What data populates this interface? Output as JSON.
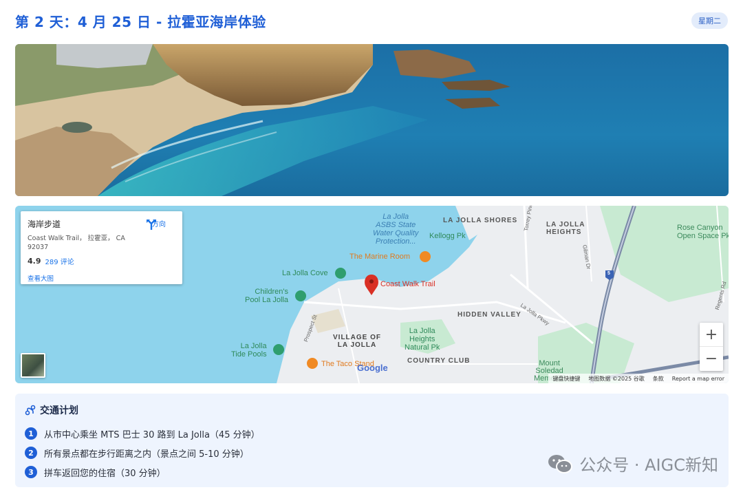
{
  "header": {
    "title": "第 2 天：4 月 25 日 - 拉霍亚海岸体验",
    "day_badge": "星期二"
  },
  "map": {
    "place_card": {
      "name": "海岸步道",
      "address": "Coast Walk Trail， 拉霍亚， CA 92037",
      "rating": "4.9",
      "reviews": "289 评论",
      "big_map_link": "查看大图",
      "directions_label": "方向"
    },
    "labels": {
      "asbs": [
        "La Jolla",
        "ASBS State",
        "Water Quality",
        "Protection..."
      ],
      "la_jolla_shores": "LA JOLLA SHORES",
      "la_jolla_heights": [
        "LA JOLLA",
        "HEIGHTS"
      ],
      "rose_canyon": [
        "Rose Canyon",
        "Open Space Pk"
      ],
      "kellogg": "Kellogg Pk",
      "marine_room": "The Marine Room",
      "la_jolla_cove": "La Jolla Cove",
      "coast_walk": "Coast Walk Trail",
      "childrens_pool": [
        "Children's",
        "Pool La Jolla"
      ],
      "hidden_valley": "HIDDEN VALLEY",
      "village": [
        "VILLAGE OF",
        "LA JOLLA"
      ],
      "heights_park": [
        "La Jolla",
        "Heights",
        "Natural Pk"
      ],
      "tide_pools": [
        "La Jolla",
        "Tide Pools"
      ],
      "taco_stand": "The Taco Stand",
      "country_club": "COUNTRY CLUB",
      "mount_soledad": [
        "Mount",
        "Soledad",
        "Memorial"
      ],
      "torrey_pines": "Torrey Pines",
      "gilman": "Gilman Dr",
      "regents": "Regents Rd",
      "prospect": "Prospect St",
      "parkway": "La Jolla Pkwy",
      "interstate": "5",
      "google": "Google"
    },
    "footer": {
      "shortcuts": "键盘快捷键",
      "data": "地图数据 ©2025 谷歌",
      "terms": "条款",
      "report": "Report a map error"
    },
    "zoom_in": "+",
    "zoom_out": "−",
    "colors": {
      "water": "#8ed3ec",
      "land": "#eceef1",
      "park": "#c8ead2",
      "highway": "#7b8aa6",
      "pin": "#d93025"
    }
  },
  "transit": {
    "title": "交通计划",
    "steps": [
      {
        "num": "1",
        "text": "从市中心乘坐 MTS 巴士 30 路到 La Jolla（45 分钟）"
      },
      {
        "num": "2",
        "text": "所有景点都在步行距离之内（景点之间 5-10 分钟）"
      },
      {
        "num": "3",
        "text": "拼车返回您的住宿（30 分钟）"
      }
    ]
  },
  "watermark": {
    "text": "公众号 · AIGC新知"
  }
}
